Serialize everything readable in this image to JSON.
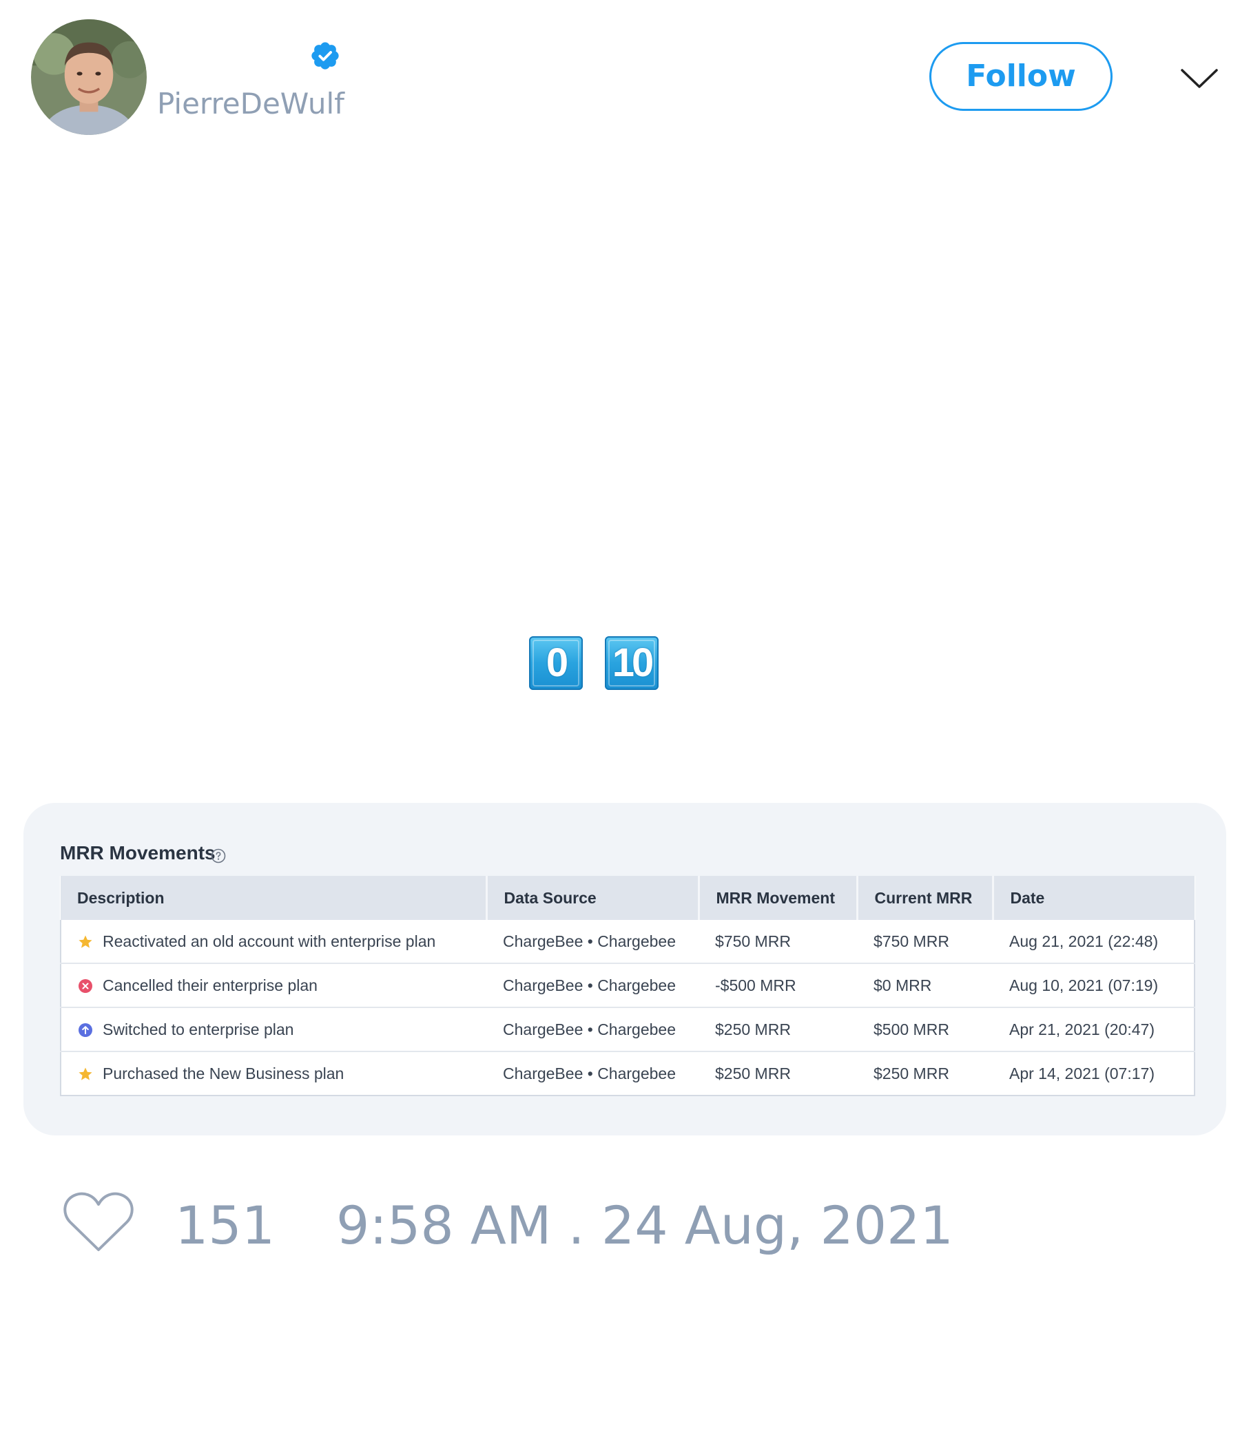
{
  "tweet": {
    "author": {
      "username": "PierreDeWulf",
      "verified": true
    },
    "follow_label": "Follow",
    "body_emoji": [
      "0",
      "10"
    ],
    "likes": "151",
    "timestamp": "9:58 AM . 24 Aug, 2021"
  },
  "card": {
    "title": "MRR Movements",
    "columns": [
      "Description",
      "Data Source",
      "MRR Movement",
      "Current MRR",
      "Date"
    ],
    "rows": [
      {
        "icon": "star-icon",
        "description": "Reactivated an old account with enterprise plan",
        "data_source": "ChargeBee • Chargebee",
        "mrr_movement": "$750 MRR",
        "current_mrr": "$750 MRR",
        "date": "Aug 21, 2021 (22:48)"
      },
      {
        "icon": "cancel-x-icon",
        "description": "Cancelled their enterprise plan",
        "data_source": "ChargeBee • Chargebee",
        "mrr_movement": "-$500 MRR",
        "current_mrr": "$0 MRR",
        "date": "Aug 10, 2021 (07:19)"
      },
      {
        "icon": "upgrade-arrow-icon",
        "description": "Switched to enterprise plan",
        "data_source": "ChargeBee • Chargebee",
        "mrr_movement": "$250 MRR",
        "current_mrr": "$500 MRR",
        "date": "Apr 21, 2021 (20:47)"
      },
      {
        "icon": "star-icon",
        "description": "Purchased the New Business plan",
        "data_source": "ChargeBee • Chargebee",
        "mrr_movement": "$250 MRR",
        "current_mrr": "$250 MRR",
        "date": "Apr 14, 2021 (07:17)"
      }
    ]
  },
  "colors": {
    "accent": "#1d9bf0",
    "muted_text": "#8f9fb4",
    "card_bg": "#f1f4f8",
    "star": "#f5b731",
    "cancel": "#e8506a",
    "upgrade": "#5a6fe0"
  }
}
